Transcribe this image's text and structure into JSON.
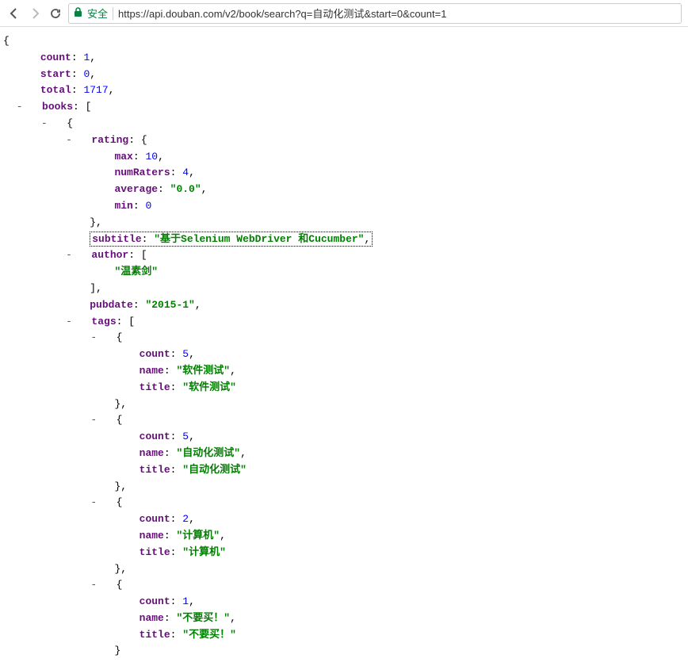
{
  "browser": {
    "secure_label": "安全",
    "url": "https://api.douban.com/v2/book/search?q=自动化测试&start=0&count=1"
  },
  "json": {
    "count": 1,
    "start": 0,
    "total": 1717,
    "books_key": "books",
    "book": {
      "rating": {
        "max": 10,
        "numRaters": 4,
        "average": "\"0.0\"",
        "min": 0
      },
      "subtitle": "\"基于Selenium WebDriver 和Cucumber\"",
      "author": [
        "\"温素剑\""
      ],
      "pubdate": "\"2015-1\"",
      "tags": [
        {
          "count": 5,
          "name": "\"软件测试\"",
          "title": "\"软件测试\""
        },
        {
          "count": 5,
          "name": "\"自动化测试\"",
          "title": "\"自动化测试\""
        },
        {
          "count": 2,
          "name": "\"计算机\"",
          "title": "\"计算机\""
        },
        {
          "count": 1,
          "name": "\"不要买！\"",
          "title": "\"不要买！\""
        }
      ]
    },
    "keys": {
      "count": "count",
      "start": "start",
      "total": "total",
      "rating": "rating",
      "max": "max",
      "numRaters": "numRaters",
      "average": "average",
      "min": "min",
      "subtitle": "subtitle",
      "author": "author",
      "pubdate": "pubdate",
      "tags": "tags",
      "name": "name",
      "title": "title"
    }
  }
}
